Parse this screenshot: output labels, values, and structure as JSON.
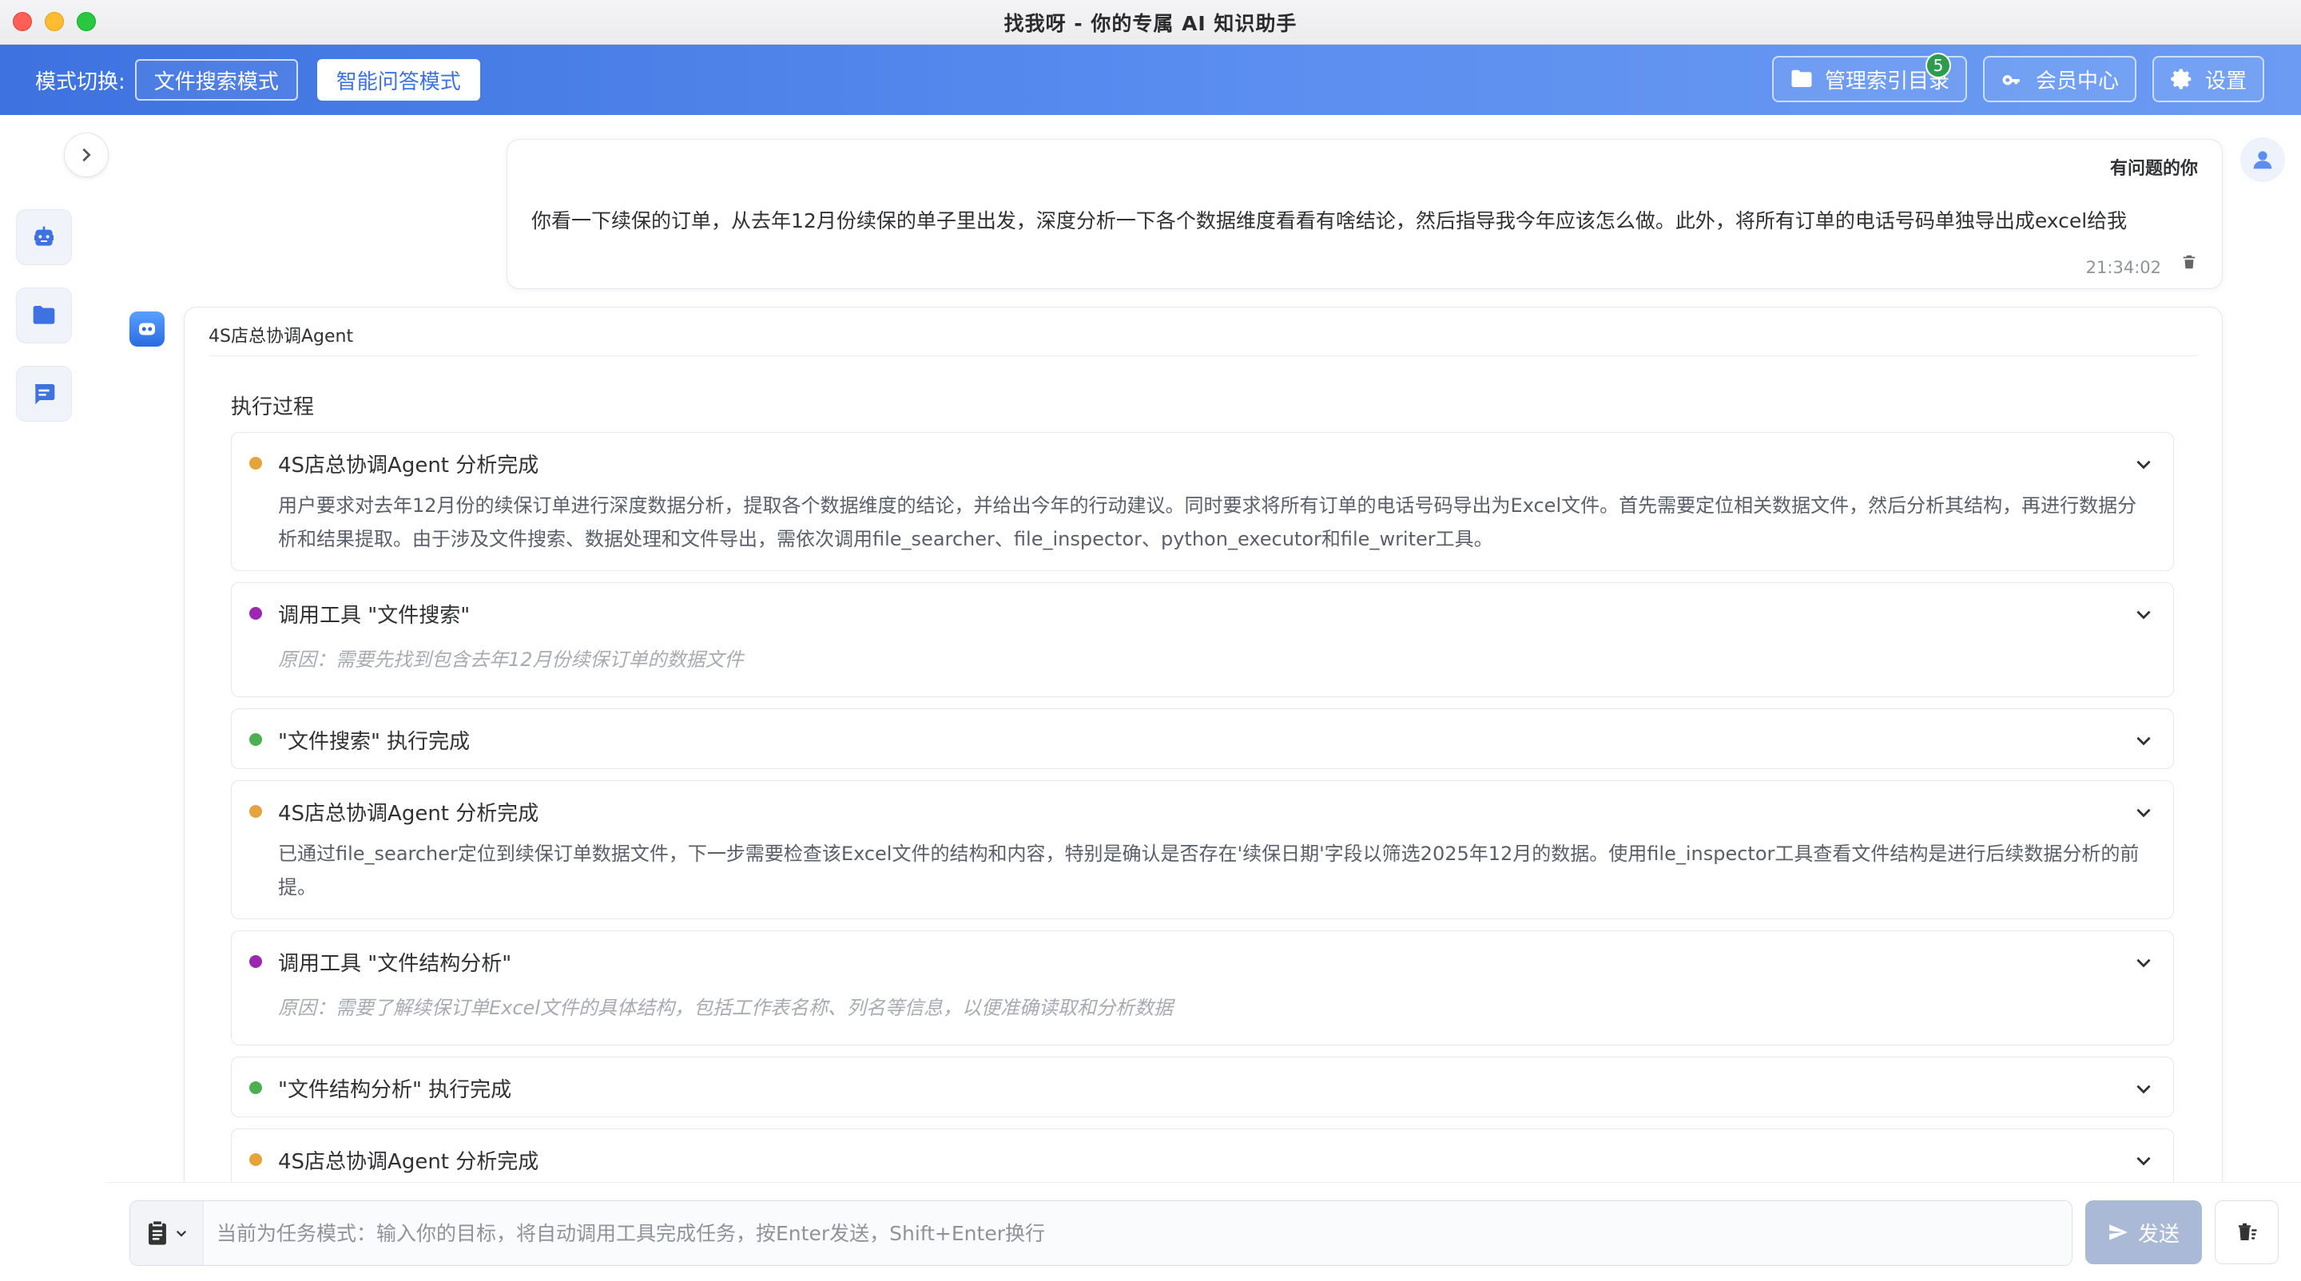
{
  "window": {
    "title": "找我呀 - 你的专属 AI 知识助手"
  },
  "toolbar": {
    "mode_label": "模式切换:",
    "modes": [
      {
        "label": "文件搜索模式",
        "active": false
      },
      {
        "label": "智能问答模式",
        "active": true
      }
    ],
    "manage_index": {
      "label": "管理索引目录",
      "badge": "5",
      "icon": "folder-icon"
    },
    "membership": {
      "label": "会员中心",
      "icon": "key-icon"
    },
    "settings": {
      "label": "设置",
      "icon": "gear-icon"
    }
  },
  "sidebar": {
    "items": [
      {
        "icon": "robot-icon"
      },
      {
        "icon": "folder-icon"
      },
      {
        "icon": "chat-icon"
      }
    ]
  },
  "user_message": {
    "sender": "有问题的你",
    "text": "你看一下续保的订单，从去年12月份续保的单子里出发，深度分析一下各个数据维度看看有啥结论，然后指导我今年应该怎么做。此外，将所有订单的电话号码单独导出成excel给我",
    "time": "21:34:02"
  },
  "agent_message": {
    "agent_name": "4S店总协调Agent",
    "process_title": "执行过程",
    "steps": [
      {
        "status": "orange",
        "title": "4S店总协调Agent 分析完成",
        "desc": "用户要求对去年12月份的续保订单进行深度数据分析，提取各个数据维度的结论，并给出今年的行动建议。同时要求将所有订单的电话号码导出为Excel文件。首先需要定位相关数据文件，然后分析其结构，再进行数据分析和结果提取。由于涉及文件搜索、数据处理和文件导出，需依次调用file_searcher、file_inspector、python_executor和file_writer工具。"
      },
      {
        "status": "purple",
        "title": "调用工具 \"文件搜索\"",
        "reason": "原因：需要先找到包含去年12月份续保订单的数据文件"
      },
      {
        "status": "green",
        "title": "\"文件搜索\" 执行完成"
      },
      {
        "status": "orange",
        "title": "4S店总协调Agent 分析完成",
        "desc": "已通过file_searcher定位到续保订单数据文件，下一步需要检查该Excel文件的结构和内容，特别是确认是否存在'续保日期'字段以筛选2025年12月的数据。使用file_inspector工具查看文件结构是进行后续数据分析的前提。"
      },
      {
        "status": "purple",
        "title": "调用工具 \"文件结构分析\"",
        "reason": "原因：需要了解续保订单Excel文件的具体结构，包括工作表名称、列名等信息，以便准确读取和分析数据"
      },
      {
        "status": "green",
        "title": "\"文件结构分析\" 执行完成"
      },
      {
        "status": "orange",
        "title": "4S店总协调Agent 分析完成"
      }
    ]
  },
  "input": {
    "placeholder": "当前为任务模式：输入你的目标，将自动调用工具完成任务，按Enter发送，Shift+Enter换行",
    "value": "",
    "send_label": "发送"
  }
}
